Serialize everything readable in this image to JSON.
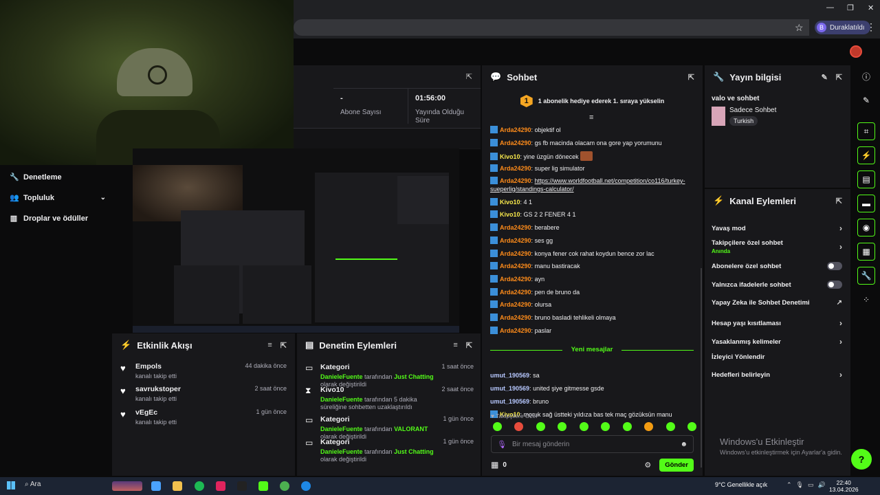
{
  "browser": {
    "profile_initial": "B",
    "profile_status": "Duraklatıldı",
    "star_icon": "☆",
    "menu_icon": "⋮",
    "minimize": "—",
    "maximize": "❐",
    "close": "✕"
  },
  "sidebar": {
    "items": [
      {
        "label": "Denetleme",
        "icon": "wrench-icon"
      },
      {
        "label": "Topluluk",
        "icon": "community-icon"
      },
      {
        "label": "Droplar ve ödüller",
        "icon": "rewards-icon"
      }
    ]
  },
  "stats": {
    "boxes": [
      {
        "value": "-",
        "label": "Abone Sayısı"
      },
      {
        "value": "01:56:00",
        "label": "Yayında Olduğu Süre"
      }
    ]
  },
  "activity": {
    "title": "Etkinlik Akışı",
    "items": [
      {
        "name": "Empols",
        "sub": "kanalı takip etti",
        "time": "44 dakika önce"
      },
      {
        "name": "savrukstoper",
        "sub": "kanalı takip etti",
        "time": "2 saat önce"
      },
      {
        "name": "vEgEc",
        "sub": "kanalı takip etti",
        "time": "1 gün önce"
      }
    ]
  },
  "moderation": {
    "title": "Denetim Eylemleri",
    "items": [
      {
        "title": "Kategori",
        "actor": "DanieleFuente",
        "mid": " tarafından ",
        "target": "Just Chatting",
        "end": " olarak değiştirildi",
        "time": "1 saat önce"
      },
      {
        "title": "Kivo10",
        "actor": "DanieleFuente",
        "mid": " tarafından 5 dakika süreliğine sohbetten uzaklaştırıldı",
        "target": "",
        "end": "",
        "time": "2 saat önce"
      },
      {
        "title": "Kategori",
        "actor": "DanieleFuente",
        "mid": " tarafından ",
        "target": "VALORANT",
        "end": " olarak değiştirildi",
        "time": "1 gün önce"
      },
      {
        "title": "Kategori",
        "actor": "DanieleFuente",
        "mid": " tarafından ",
        "target": "Just Chatting",
        "end": " olarak değiştirildi",
        "time": "1 gün önce"
      }
    ]
  },
  "chat": {
    "title": "Sohbet",
    "banner": "1 abonelik hediye ederek 1. sıraya yükselin",
    "banner_rank": "1",
    "messages": [
      {
        "user": "Arda24290",
        "color": "or",
        "text": "objektif ol"
      },
      {
        "user": "Arda24290",
        "color": "or",
        "text": "gs fb macinda olacam ona gore yap yorumunu"
      },
      {
        "user": "Kivo10",
        "color": "ye",
        "text": "yine üzgün dönecek"
      },
      {
        "user": "Arda24290",
        "color": "or",
        "text": "super lig simulator"
      },
      {
        "user": "Arda24290",
        "color": "or",
        "link": "https://www.worldfootball.net/competition/co116/turkey-sueperlig/standings-calculator/"
      },
      {
        "user": "Kivo10",
        "color": "ye",
        "text": "4 1"
      },
      {
        "user": "Kivo10",
        "color": "ye",
        "text": "GS 2 2 FENER 4 1"
      },
      {
        "user": "Arda24290",
        "color": "or",
        "text": "berabere"
      },
      {
        "user": "Arda24290",
        "color": "or",
        "text": "ses gg"
      },
      {
        "user": "Arda24290",
        "color": "or",
        "text": "konya fener cok rahat koydun bence zor lac"
      },
      {
        "user": "Arda24290",
        "color": "or",
        "text": "manu bastiracak"
      },
      {
        "user": "Arda24290",
        "color": "or",
        "text": "ayn"
      },
      {
        "user": "Arda24290",
        "color": "or",
        "text": "pen de bruno da"
      },
      {
        "user": "Arda24290",
        "color": "or",
        "text": "olursa"
      },
      {
        "user": "Arda24290",
        "color": "or",
        "text": "bruno basladi tehlikeli olmaya"
      },
      {
        "user": "Arda24290",
        "color": "or",
        "text": "paslar"
      }
    ],
    "new_messages_label": "Yeni mesajlar",
    "new_messages": [
      {
        "user": "umut_190569",
        "color": "bl",
        "text": "sa"
      },
      {
        "user": "umut_190569",
        "color": "bl",
        "text": "united şiye gitmesse gsde"
      },
      {
        "user": "umut_190569",
        "color": "bl",
        "text": "bruno"
      },
      {
        "user": "Kivo10",
        "color": "ye",
        "text": "moruk sağ üstteki yıldıza bas tek maç gözüksün manu"
      }
    ],
    "emote_label": "Takipçilere Özel",
    "input_placeholder": "Bir mesaj gönderin",
    "points": "0",
    "send_label": "Gönder"
  },
  "info": {
    "title": "Yayın bilgisi",
    "stream_title": "valo ve sohbet",
    "category": "Sadece Sohbet",
    "language": "Turkish"
  },
  "actions": {
    "title": "Kanal Eylemleri",
    "items": [
      {
        "label": "Yavaş mod",
        "kind": "chevron"
      },
      {
        "label": "Takipçilere özel sohbet",
        "sub": "Anında",
        "kind": "chevron"
      },
      {
        "label": "Abonelere özel sohbet",
        "kind": "toggle"
      },
      {
        "label": "Yalnızca ifadelerle sohbet",
        "kind": "toggle"
      },
      {
        "label": "Yapay Zeka ile Sohbet Denetimi",
        "kind": "external"
      },
      {
        "label": "Hesap yaşı kısıtlaması",
        "kind": "chevron"
      },
      {
        "label": "Yasaklanmış kelimeler",
        "kind": "chevron"
      },
      {
        "label": "İzleyici Yönlendir",
        "kind": "none"
      },
      {
        "label": "Hedefleri belirleyin",
        "kind": "chevron"
      }
    ]
  },
  "windows": {
    "watermark_title": "Windows'u Etkinleştir",
    "watermark_sub": "Windows'u etkinleştirmek için Ayarlar'a gidin.",
    "search": "Ara",
    "weather": "9°C  Genellikle açık",
    "time": "22:40",
    "date": "13.04.2026"
  },
  "colors": {
    "accent": "#53fc18",
    "panel": "#18181b",
    "bg": "#0b0b0c",
    "orange_user": "#ff8c1a",
    "yellow_user": "#f7e84c"
  }
}
